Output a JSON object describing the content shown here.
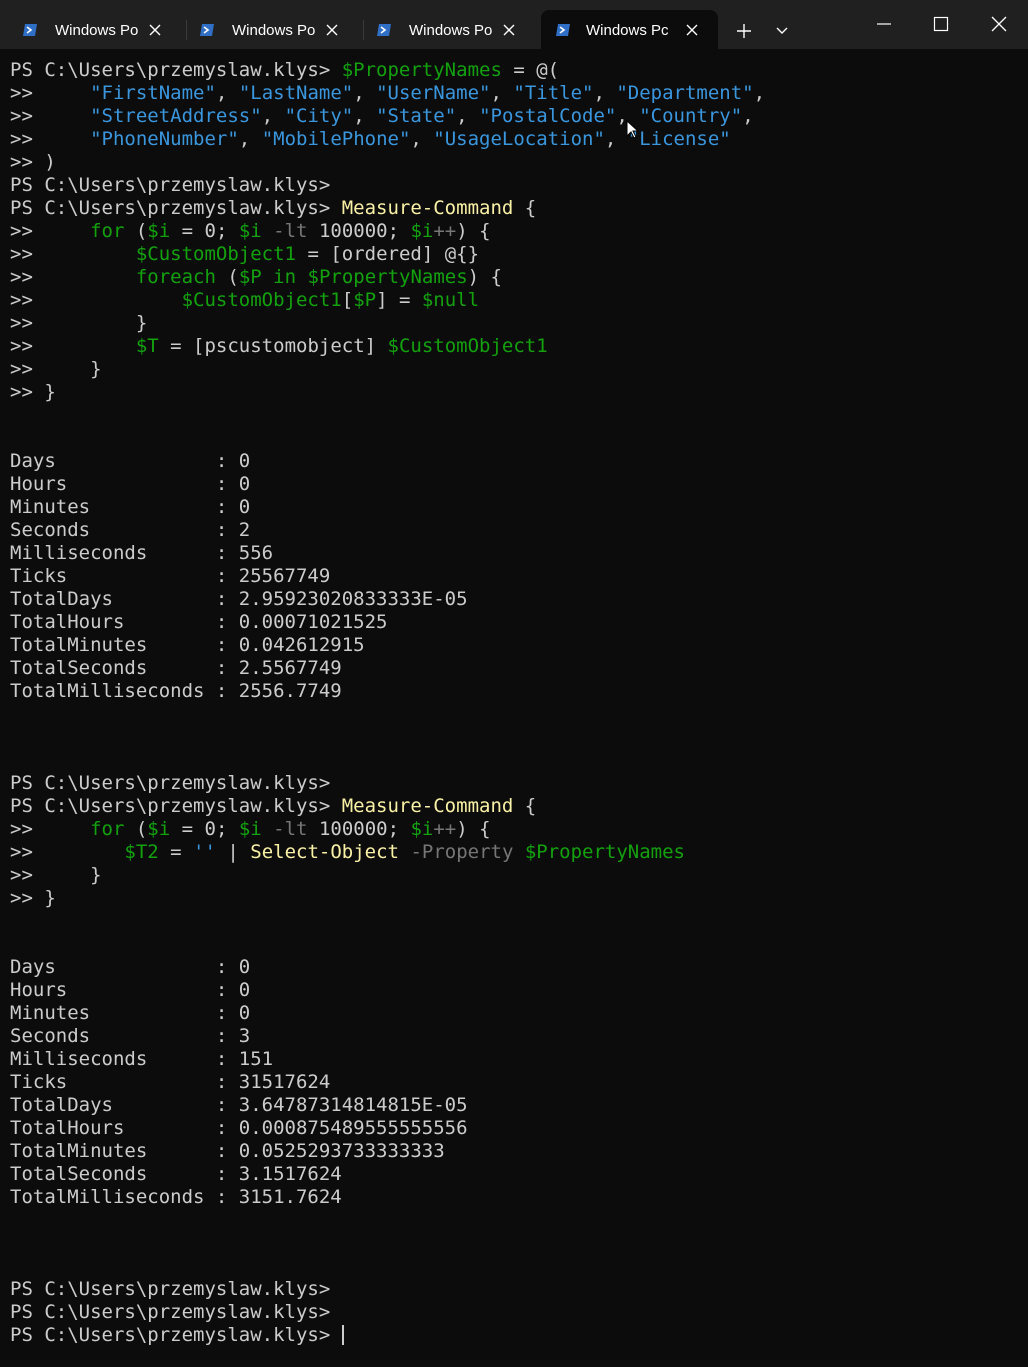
{
  "tabs": [
    {
      "label": "Windows Po",
      "active": false
    },
    {
      "label": "Windows Po",
      "active": false
    },
    {
      "label": "Windows Po",
      "active": false
    },
    {
      "label": "Windows Pc",
      "active": true
    }
  ],
  "titlebar": {
    "new_tab_icon": "plus-icon",
    "dropdown_icon": "chevron-down-icon",
    "minimize_icon": "minimize-icon",
    "maximize_icon": "maximize-icon",
    "close_icon": "close-icon"
  },
  "colors": {
    "background": "#0c0c0c",
    "text": "#cccccc",
    "variable": "#13a10e",
    "string": "#3a96dd",
    "command": "#f9f1a5",
    "parameter": "#767676",
    "titlebar": "#202020"
  },
  "terminal": {
    "prompt": "PS C:\\Users\\przemyslaw.klys> ",
    "cont": ">> ",
    "lines": [
      [
        [
          "p",
          "PS C:\\Users\\przemyslaw.klys> "
        ],
        [
          "v",
          "$PropertyNames"
        ],
        [
          "t",
          " = @("
        ]
      ],
      [
        [
          "t",
          ">>     "
        ],
        [
          "s",
          "\"FirstName\""
        ],
        [
          "t",
          ", "
        ],
        [
          "s",
          "\"LastName\""
        ],
        [
          "t",
          ", "
        ],
        [
          "s",
          "\"UserName\""
        ],
        [
          "t",
          ", "
        ],
        [
          "s",
          "\"Title\""
        ],
        [
          "t",
          ", "
        ],
        [
          "s",
          "\"Department\""
        ],
        [
          "t",
          ","
        ]
      ],
      [
        [
          "t",
          ">>     "
        ],
        [
          "s",
          "\"StreetAddress\""
        ],
        [
          "t",
          ", "
        ],
        [
          "s",
          "\"City\""
        ],
        [
          "t",
          ", "
        ],
        [
          "s",
          "\"State\""
        ],
        [
          "t",
          ", "
        ],
        [
          "s",
          "\"PostalCode\""
        ],
        [
          "t",
          ", "
        ],
        [
          "s",
          "\"Country\""
        ],
        [
          "t",
          ","
        ]
      ],
      [
        [
          "t",
          ">>     "
        ],
        [
          "s",
          "\"PhoneNumber\""
        ],
        [
          "t",
          ", "
        ],
        [
          "s",
          "\"MobilePhone\""
        ],
        [
          "t",
          ", "
        ],
        [
          "s",
          "\"UsageLocation\""
        ],
        [
          "t",
          ", "
        ],
        [
          "s",
          "\"License\""
        ]
      ],
      [
        [
          "t",
          ">> )"
        ]
      ],
      [
        [
          "p",
          "PS C:\\Users\\przemyslaw.klys>"
        ]
      ],
      [
        [
          "p",
          "PS C:\\Users\\przemyslaw.klys> "
        ],
        [
          "c",
          "Measure-Command"
        ],
        [
          "t",
          " {"
        ]
      ],
      [
        [
          "t",
          ">>     "
        ],
        [
          "v",
          "for"
        ],
        [
          "t",
          " ("
        ],
        [
          "v",
          "$i"
        ],
        [
          "t",
          " = 0; "
        ],
        [
          "v",
          "$i"
        ],
        [
          "t",
          " "
        ],
        [
          "o",
          "-lt"
        ],
        [
          "t",
          " 100000; "
        ],
        [
          "v",
          "$i"
        ],
        [
          "o",
          "++"
        ],
        [
          "t",
          ") {"
        ]
      ],
      [
        [
          "t",
          ">>         "
        ],
        [
          "v",
          "$CustomObject1"
        ],
        [
          "t",
          " = [ordered] @{}"
        ]
      ],
      [
        [
          "t",
          ">>         "
        ],
        [
          "v",
          "foreach"
        ],
        [
          "t",
          " ("
        ],
        [
          "v",
          "$P"
        ],
        [
          "t",
          " "
        ],
        [
          "v",
          "in"
        ],
        [
          "t",
          " "
        ],
        [
          "v",
          "$PropertyNames"
        ],
        [
          "t",
          ") {"
        ]
      ],
      [
        [
          "t",
          ">>             "
        ],
        [
          "v",
          "$CustomObject1"
        ],
        [
          "t",
          "["
        ],
        [
          "v",
          "$P"
        ],
        [
          "t",
          "] = "
        ],
        [
          "v",
          "$null"
        ]
      ],
      [
        [
          "t",
          ">>         }"
        ]
      ],
      [
        [
          "t",
          ">>         "
        ],
        [
          "v",
          "$T"
        ],
        [
          "t",
          " = [pscustomobject] "
        ],
        [
          "v",
          "$CustomObject1"
        ]
      ],
      [
        [
          "t",
          ">>     }"
        ]
      ],
      [
        [
          "t",
          ">> }"
        ]
      ],
      [],
      [],
      [
        [
          "t",
          "Days              : 0"
        ]
      ],
      [
        [
          "t",
          "Hours             : 0"
        ]
      ],
      [
        [
          "t",
          "Minutes           : 0"
        ]
      ],
      [
        [
          "t",
          "Seconds           : 2"
        ]
      ],
      [
        [
          "t",
          "Milliseconds      : 556"
        ]
      ],
      [
        [
          "t",
          "Ticks             : 25567749"
        ]
      ],
      [
        [
          "t",
          "TotalDays         : 2.95923020833333E-05"
        ]
      ],
      [
        [
          "t",
          "TotalHours        : 0.00071021525"
        ]
      ],
      [
        [
          "t",
          "TotalMinutes      : 0.042612915"
        ]
      ],
      [
        [
          "t",
          "TotalSeconds      : 2.5567749"
        ]
      ],
      [
        [
          "t",
          "TotalMilliseconds : 2556.7749"
        ]
      ],
      [],
      [],
      [],
      [
        [
          "p",
          "PS C:\\Users\\przemyslaw.klys>"
        ]
      ],
      [
        [
          "p",
          "PS C:\\Users\\przemyslaw.klys> "
        ],
        [
          "c",
          "Measure-Command"
        ],
        [
          "t",
          " {"
        ]
      ],
      [
        [
          "t",
          ">>     "
        ],
        [
          "v",
          "for"
        ],
        [
          "t",
          " ("
        ],
        [
          "v",
          "$i"
        ],
        [
          "t",
          " = 0; "
        ],
        [
          "v",
          "$i"
        ],
        [
          "t",
          " "
        ],
        [
          "o",
          "-lt"
        ],
        [
          "t",
          " 100000; "
        ],
        [
          "v",
          "$i"
        ],
        [
          "o",
          "++"
        ],
        [
          "t",
          ") {"
        ]
      ],
      [
        [
          "t",
          ">>        "
        ],
        [
          "v",
          "$T2"
        ],
        [
          "t",
          " = "
        ],
        [
          "s",
          "''"
        ],
        [
          "t",
          " | "
        ],
        [
          "c",
          "Select-Object"
        ],
        [
          "t",
          " "
        ],
        [
          "o",
          "-Property"
        ],
        [
          "t",
          " "
        ],
        [
          "v",
          "$PropertyNames"
        ]
      ],
      [
        [
          "t",
          ">>     }"
        ]
      ],
      [
        [
          "t",
          ">> }"
        ]
      ],
      [],
      [],
      [
        [
          "t",
          "Days              : 0"
        ]
      ],
      [
        [
          "t",
          "Hours             : 0"
        ]
      ],
      [
        [
          "t",
          "Minutes           : 0"
        ]
      ],
      [
        [
          "t",
          "Seconds           : 3"
        ]
      ],
      [
        [
          "t",
          "Milliseconds      : 151"
        ]
      ],
      [
        [
          "t",
          "Ticks             : 31517624"
        ]
      ],
      [
        [
          "t",
          "TotalDays         : 3.64787314814815E-05"
        ]
      ],
      [
        [
          "t",
          "TotalHours        : 0.000875489555555556"
        ]
      ],
      [
        [
          "t",
          "TotalMinutes      : 0.0525293733333333"
        ]
      ],
      [
        [
          "t",
          "TotalSeconds      : 3.1517624"
        ]
      ],
      [
        [
          "t",
          "TotalMilliseconds : 3151.7624"
        ]
      ],
      [],
      [],
      [],
      [
        [
          "p",
          "PS C:\\Users\\przemyslaw.klys>"
        ]
      ],
      [
        [
          "p",
          "PS C:\\Users\\przemyslaw.klys>"
        ]
      ],
      [
        [
          "p",
          "PS C:\\Users\\przemyslaw.klys> "
        ],
        [
          "cursor",
          ""
        ]
      ]
    ]
  }
}
